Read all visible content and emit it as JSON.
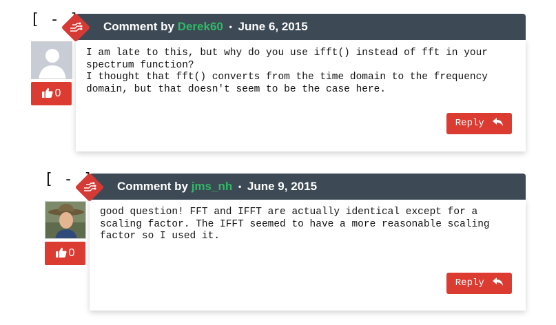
{
  "colors": {
    "header_bg": "#3d4a55",
    "accent_red": "#dc3b32",
    "author_green": "#2fb866"
  },
  "comments": [
    {
      "toggle": "[ - ]",
      "prefix": "Comment by",
      "author": "Derek60",
      "separator": "•",
      "date": "June 6, 2015",
      "text": "I am late to this, but why do you use ifft() instead of fft in your spectrum function?\nI thought that fft() converts from the time domain to the frequency domain, but that doesn't seem to be the case here.",
      "likes": "0",
      "reply_label": "Reply",
      "avatar_icon": "default-user-silhouette",
      "like_icon": "thumbs-up-icon",
      "reply_icon": "reply-arrow-icon"
    },
    {
      "toggle": "[ - ]",
      "prefix": "Comment by",
      "author": "jms_nh",
      "separator": "•",
      "date": "June 9, 2015",
      "text": "good question! FFT and IFFT are actually identical except for a scaling factor. The IFFT seemed to have a more reasonable scaling factor so I used it.",
      "likes": "0",
      "reply_label": "Reply",
      "avatar_icon": "user-photo",
      "like_icon": "thumbs-up-icon",
      "reply_icon": "reply-arrow-icon"
    }
  ]
}
